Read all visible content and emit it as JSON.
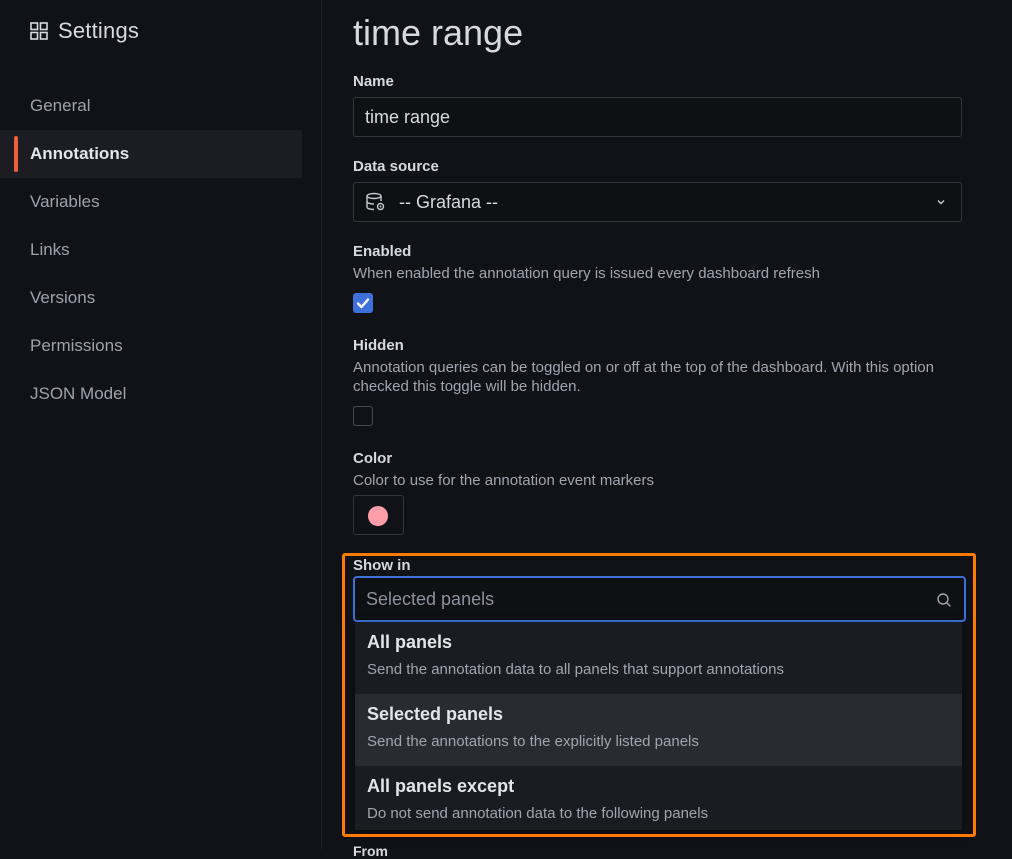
{
  "sidebar": {
    "title": "Settings",
    "items": [
      {
        "label": "General"
      },
      {
        "label": "Annotations"
      },
      {
        "label": "Variables"
      },
      {
        "label": "Links"
      },
      {
        "label": "Versions"
      },
      {
        "label": "Permissions"
      },
      {
        "label": "JSON Model"
      }
    ],
    "active": "Annotations",
    "accent_color": "#f0613a"
  },
  "main": {
    "title": "time range",
    "name": {
      "label": "Name",
      "value": "time range"
    },
    "data_source": {
      "label": "Data source",
      "value": "-- Grafana --",
      "icon": "database-gear-icon"
    },
    "enabled": {
      "label": "Enabled",
      "description": "When enabled the annotation query is issued every dashboard refresh",
      "checked": true
    },
    "hidden": {
      "label": "Hidden",
      "description": "Annotation queries can be toggled on or off at the top of the dashboard. With this option checked this toggle will be hidden.",
      "checked": false
    },
    "color": {
      "label": "Color",
      "description": "Color to use for the annotation event markers",
      "value": "#ff9ea8"
    },
    "show_in": {
      "label": "Show in",
      "placeholder": "Selected panels",
      "options": [
        {
          "label": "All panels",
          "description": "Send the annotation data to all panels that support annotations"
        },
        {
          "label": "Selected panels",
          "description": "Send the annotations to the explicitly listed panels"
        },
        {
          "label": "All panels except",
          "description": "Do not send annotation data to the following panels"
        }
      ],
      "highlighted_option": "Selected panels"
    },
    "from_label": "From"
  },
  "colors": {
    "checkbox_checked": "#3d71d9",
    "focus_border": "#3d71d9",
    "callout_border": "#ff7a00"
  }
}
